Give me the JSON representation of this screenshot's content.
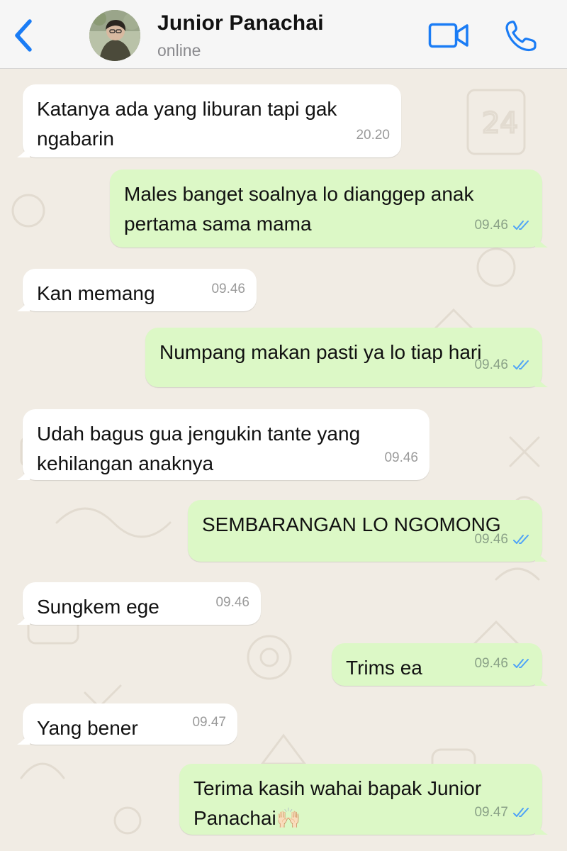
{
  "header": {
    "contact_name": "Junior Panachai",
    "status": "online",
    "back_icon": "chevron-left-icon",
    "video_icon": "video-camera-icon",
    "call_icon": "phone-icon",
    "accent_color": "#1a7cf5"
  },
  "messages": [
    {
      "dir": "in",
      "text": "Katanya ada yang liburan tapi gak\nngabarin",
      "time": "20.20"
    },
    {
      "dir": "out",
      "text": "Males banget soalnya lo dianggep anak\npertama sama mama",
      "time": "09.46",
      "status": "read"
    },
    {
      "dir": "in",
      "text": "Kan memang",
      "time": "09.46"
    },
    {
      "dir": "out",
      "text": "Numpang makan pasti ya lo tiap hari",
      "time": "09.46",
      "status": "read"
    },
    {
      "dir": "in",
      "text": "Udah bagus gua jengukin tante yang\nkehilangan anaknya",
      "time": "09.46"
    },
    {
      "dir": "out",
      "text": "SEMBARANGAN LO NGOMONG",
      "time": "09.46",
      "status": "read"
    },
    {
      "dir": "in",
      "text": "Sungkem ege",
      "time": "09.46"
    },
    {
      "dir": "out",
      "text": "Trims ea",
      "time": "09.46",
      "status": "read"
    },
    {
      "dir": "in",
      "text": "Yang bener",
      "time": "09.47"
    },
    {
      "dir": "out",
      "text": "Terima kasih wahai bapak Junior\nPanachai🙌🏻",
      "time": "09.47",
      "status": "read"
    }
  ],
  "colors": {
    "incoming_bubble": "#ffffff",
    "outgoing_bubble": "#dcf8c6",
    "read_tick": "#4fa3f7",
    "wallpaper": "#f1ece4"
  }
}
